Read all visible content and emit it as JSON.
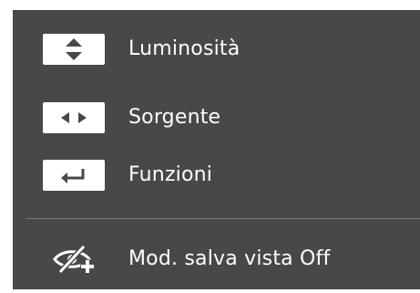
{
  "colors": {
    "panel_background": "#484848",
    "text": "#ffffff",
    "key_background": "#ffffff",
    "key_glyph": "#484848",
    "divider": "#7a7a7a"
  },
  "menu": {
    "items": [
      {
        "icon": "up-down-arrows-icon",
        "label": "Luminosità"
      },
      {
        "icon": "left-right-arrows-icon",
        "label": "Sorgente"
      },
      {
        "icon": "enter-return-icon",
        "label": "Funzioni"
      }
    ],
    "eye_saver": {
      "icon": "eye-saver-icon",
      "label": "Mod. salva vista Off"
    }
  }
}
